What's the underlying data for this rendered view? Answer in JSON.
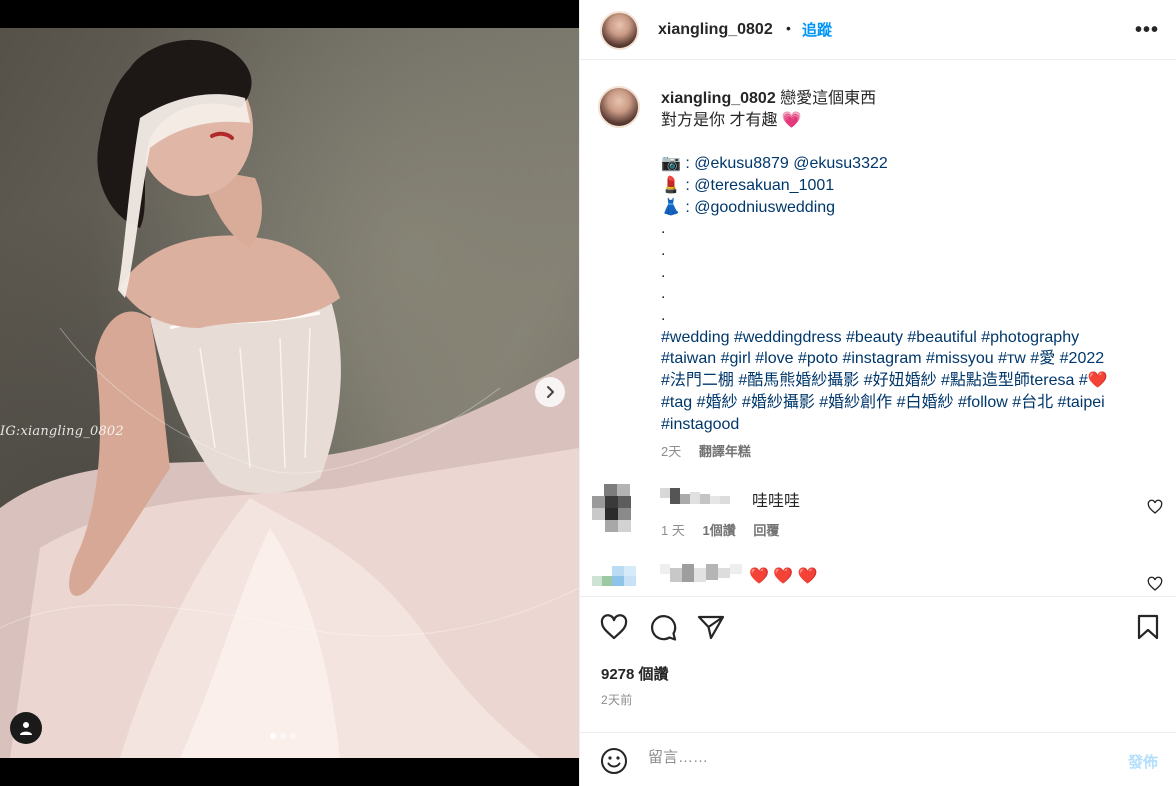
{
  "media": {
    "watermark": "IG:xiangling_0802",
    "carousel": {
      "total": 3,
      "current": 1
    }
  },
  "header": {
    "username": "xiangling_0802",
    "separator": "•",
    "follow_label": "追蹤",
    "more_label": "•••"
  },
  "caption": {
    "username": "xiangling_0802",
    "lines": [
      "戀愛這個東西",
      "對方是你 才有趣 💗",
      "",
      "📷 : @ekusu8879 @ekusu3322",
      "💄 : @teresakuan_1001",
      "👗 : @goodniuswedding",
      ".",
      ".",
      ".",
      ".",
      "."
    ],
    "hashtag_lines": [
      "#wedding #weddingdress #beauty #beautiful #photography",
      "#taiwan #girl #love #poto #instagram #missyou #ᴛᴡ #愛 #2022",
      "#法門二棚 #酷馬熊婚紗攝影 #好妞婚紗 #點點造型師teresa #❤️",
      "#tag #婚紗 #婚紗攝影 #婚紗創作 #白婚紗 #follow #台北 #taipei",
      "#instagood"
    ],
    "time": "2天",
    "translate_label": "翻譯年糕"
  },
  "comments": [
    {
      "text": "哇哇哇",
      "time": "1 天",
      "likes": "1個讚",
      "reply_label": "回覆"
    },
    {
      "text": "❤️ ❤️ ❤️"
    }
  ],
  "likes": "9278 個讚",
  "post_time": "2天前",
  "comment_box": {
    "placeholder": "留言……",
    "post_label": "發佈"
  },
  "colors": {
    "link": "#0095f6",
    "hashtag": "#00376b",
    "muted": "#8e8e8e",
    "heart": "#ed4956"
  },
  "icons": [
    "heart-icon",
    "comment-icon",
    "share-icon",
    "save-icon",
    "emoji-icon",
    "chevron-right-icon",
    "user-tag-icon"
  ]
}
